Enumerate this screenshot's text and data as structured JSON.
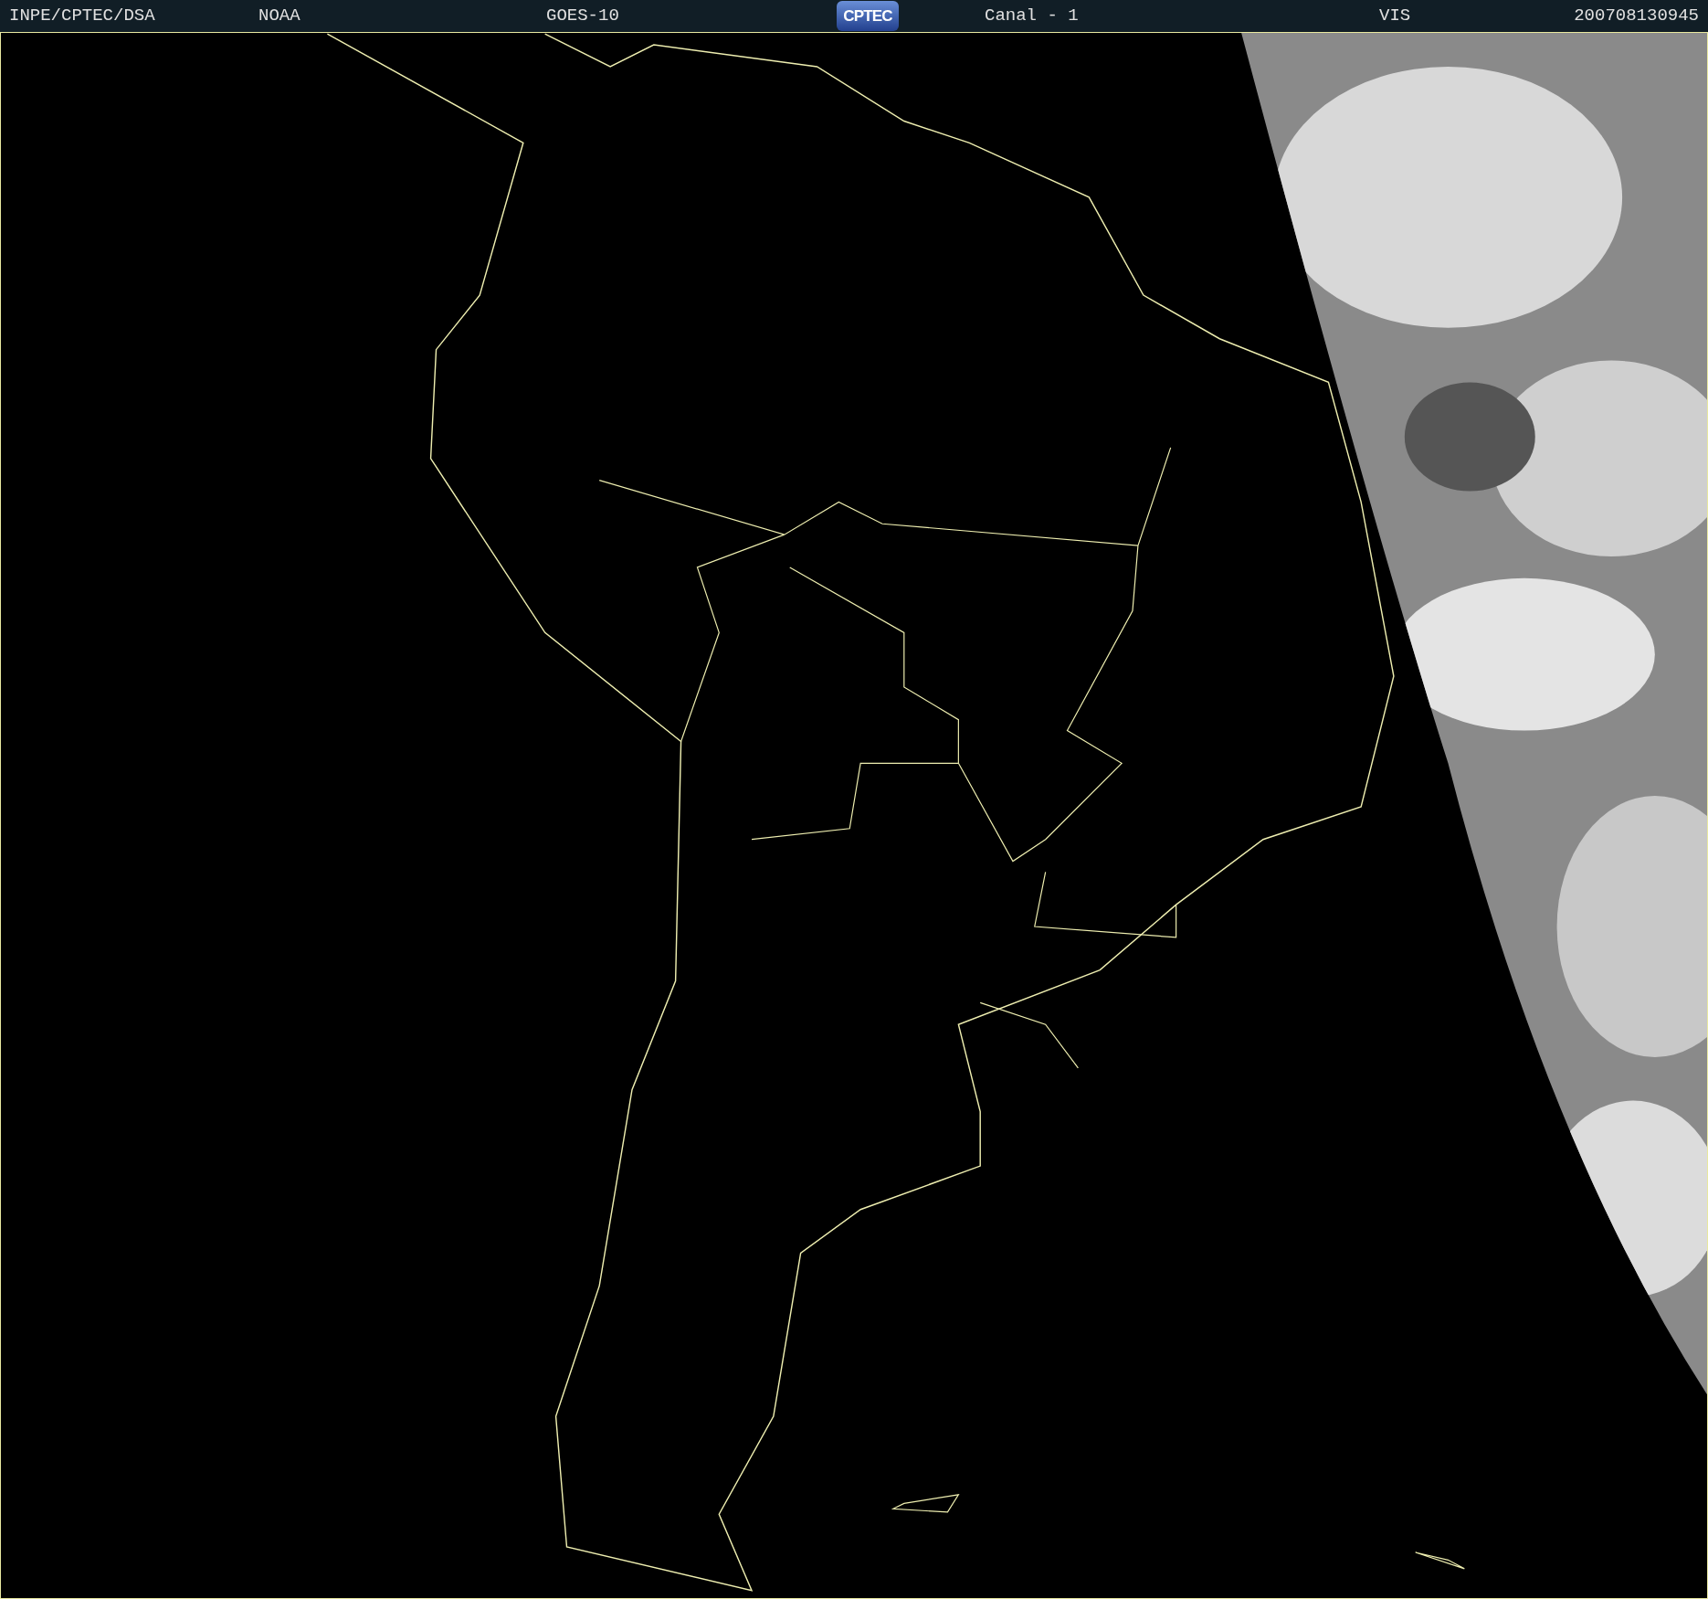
{
  "header": {
    "source": "INPE/CPTEC/DSA",
    "agency": "NOAA",
    "satellite": "GOES-10",
    "logo_text": "CPTEC",
    "channel": "Canal - 1",
    "band": "VIS",
    "timestamp": "200708130945"
  }
}
